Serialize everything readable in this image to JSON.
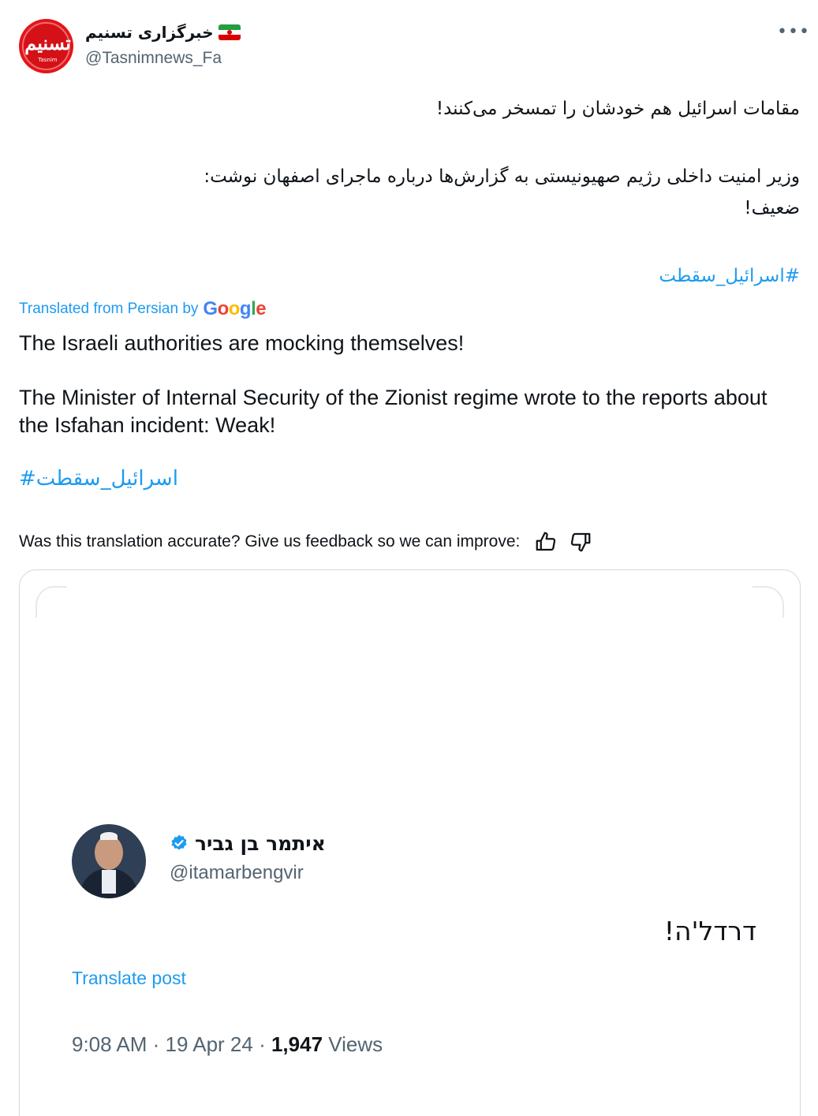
{
  "author": {
    "display_name": "خبرگزاری تسنیم",
    "handle": "@Tasnimnews_Fa",
    "avatar_text": "تسنیم",
    "avatar_subtext": "Tasnim"
  },
  "more_label": "•••",
  "tweet_fa": {
    "line1": "مقامات اسرائیل هم خودشان را تمسخر می‌کنند!",
    "line2": "وزیر امنیت داخلی رژیم صهیونیستی به گزارش‌ها درباره ماجرای اصفهان نوشت:",
    "line3": "ضعیف!",
    "hashtag": "#اسرائیل_سقطت"
  },
  "translation": {
    "label": "Translated from Persian by",
    "provider": "Google",
    "line1": "The Israeli authorities are mocking themselves!",
    "line2": "The Minister of Internal Security of the Zionist regime wrote to the reports about the Isfahan incident: Weak!",
    "hashtag": "#اسرائیل_سقطت"
  },
  "feedback": {
    "question": "Was this translation accurate? Give us feedback so we can improve:"
  },
  "quoted": {
    "display_name": "איתמר בן גביר",
    "handle": "@itamarbengvir",
    "text": "דרדל'ה!",
    "translate_label": "Translate post",
    "time": "9:08 AM",
    "date": "19 Apr 24",
    "views_count": "1,947",
    "views_label": "Views"
  },
  "colors": {
    "accent": "#1d9bf0",
    "secondary_text": "#536471",
    "primary_text": "#0f1419",
    "border": "#cfd9de",
    "brand_red": "#e3151a"
  },
  "icons": [
    "more-icon",
    "iran-flag-icon",
    "thumbs-up-icon",
    "thumbs-down-icon",
    "verified-badge-icon"
  ]
}
